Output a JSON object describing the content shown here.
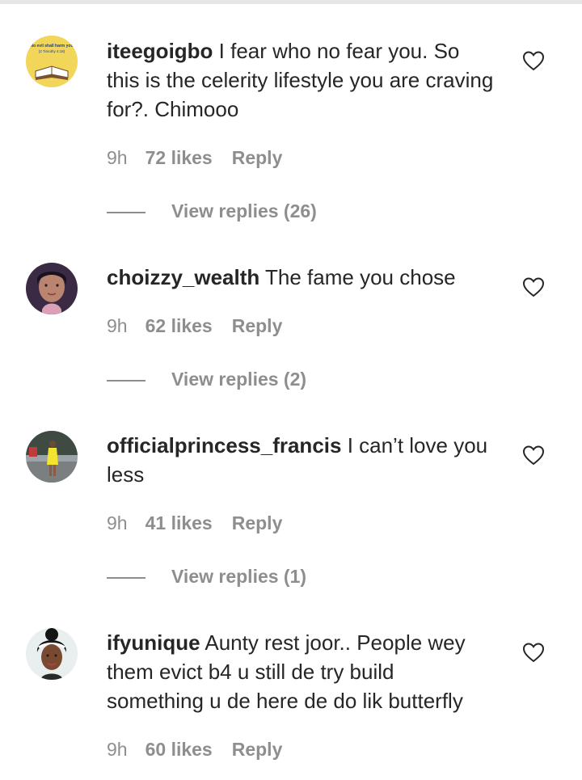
{
  "comments": [
    {
      "username": "iteegoigbo",
      "text": " I fear who no fear you. So this is the celerity lifestyle you are craving for?. Chimooo",
      "time": "9h",
      "likes": "72 likes",
      "reply": "Reply",
      "view_replies": "View replies (26)",
      "avatar_text_1": "No evil shall harm you",
      "avatar_text_2": "(2 Timothy 4:18)"
    },
    {
      "username": "choizzy_wealth",
      "text": " The fame you chose",
      "time": "9h",
      "likes": "62 likes",
      "reply": "Reply",
      "view_replies": "View replies (2)"
    },
    {
      "username": "officialprincess_francis",
      "text": " I can’t love you less",
      "time": "9h",
      "likes": "41 likes",
      "reply": "Reply",
      "view_replies": "View replies (1)"
    },
    {
      "username": "ifyunique",
      "text": " Aunty rest joor.. People wey them evict b4 u still de try build something u de here de do lik butterfly",
      "time": "9h",
      "likes": "60 likes",
      "reply": "Reply"
    }
  ],
  "icons": {
    "like": "heart-outline-icon"
  },
  "colors": {
    "text": "#262626",
    "secondary": "#8e8e8e"
  }
}
